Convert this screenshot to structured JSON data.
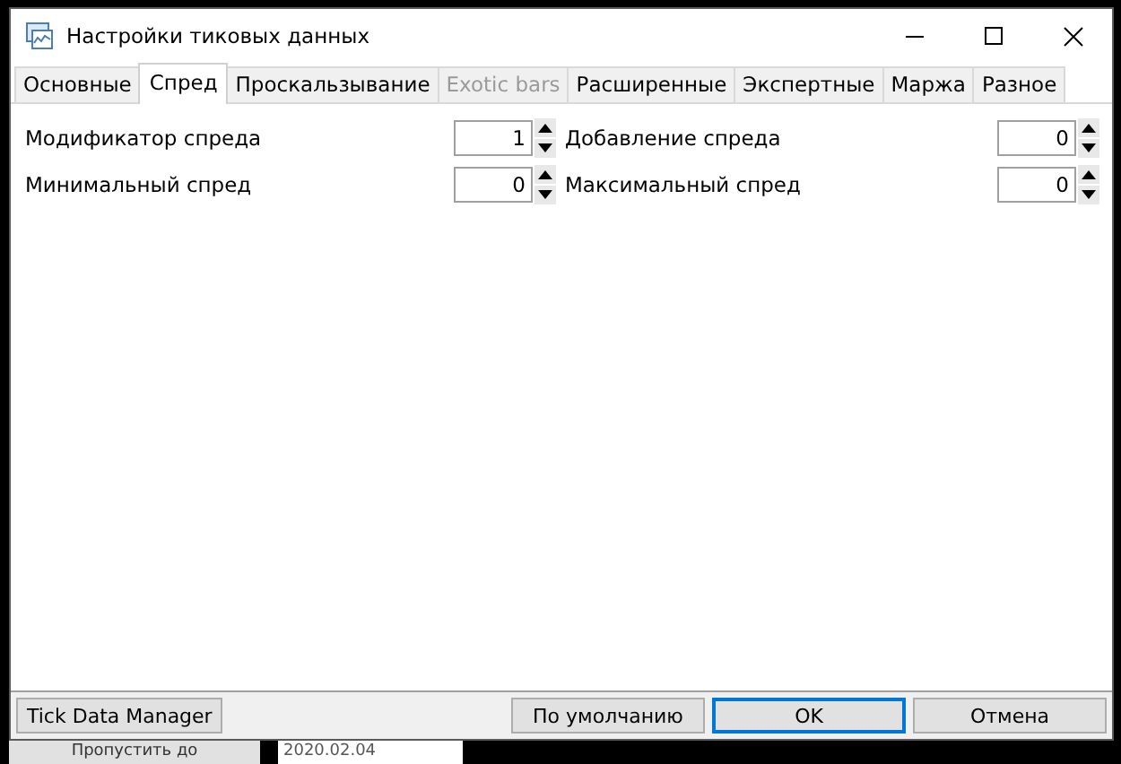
{
  "window": {
    "title": "Настройки тиковых данных"
  },
  "tabs": [
    {
      "label": "Основные",
      "selected": false,
      "disabled": false
    },
    {
      "label": "Спред",
      "selected": true,
      "disabled": false
    },
    {
      "label": "Проскальзывание",
      "selected": false,
      "disabled": false
    },
    {
      "label": "Exotic bars",
      "selected": false,
      "disabled": true
    },
    {
      "label": "Расширенные",
      "selected": false,
      "disabled": false
    },
    {
      "label": "Экспертные",
      "selected": false,
      "disabled": false
    },
    {
      "label": "Маржа",
      "selected": false,
      "disabled": false
    },
    {
      "label": "Разное",
      "selected": false,
      "disabled": false
    }
  ],
  "fields": [
    {
      "label": "Модификатор спреда",
      "value": "1"
    },
    {
      "label": "Добавление спреда",
      "value": "0"
    },
    {
      "label": "Минимальный спред",
      "value": "0"
    },
    {
      "label": "Максимальный спред",
      "value": "0"
    }
  ],
  "buttons": [
    {
      "label": "Tick Data Manager",
      "default": false
    },
    {
      "label": "По умолчанию",
      "default": false
    },
    {
      "label": "OK",
      "default": true
    },
    {
      "label": "Отмена",
      "default": false
    }
  ],
  "background": {
    "button": "Пропустить до",
    "date_field": "2020.02.04"
  }
}
